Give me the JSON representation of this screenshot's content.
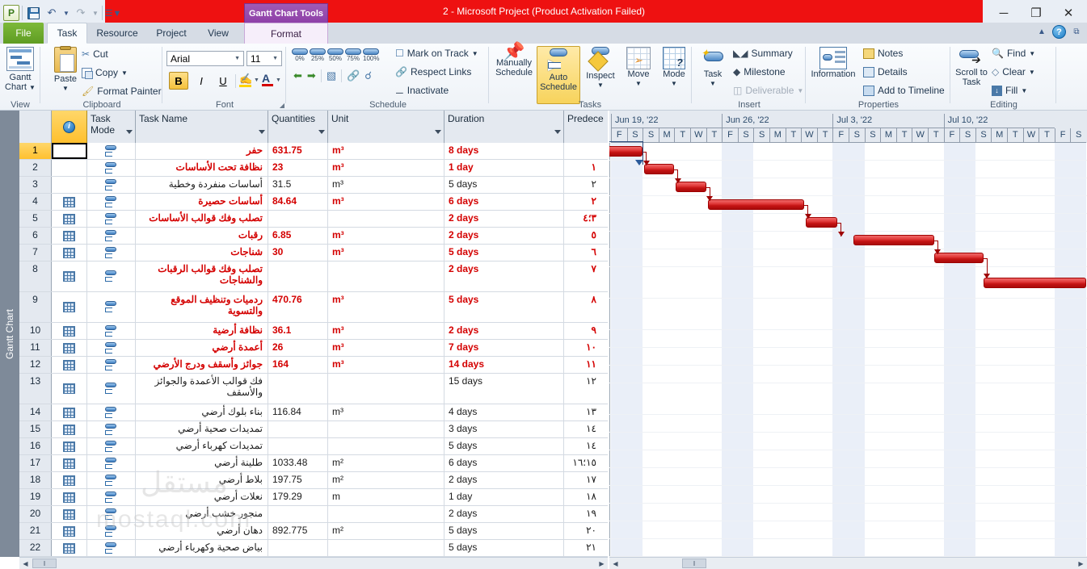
{
  "window": {
    "title": "2 -  Microsoft Project (Product Activation Failed)",
    "contextual_tab": "Gantt Chart Tools",
    "minimize": "─",
    "restore": "❐",
    "close": "✕"
  },
  "quick_access": {
    "app_icon": "P",
    "save_icon": "save-icon",
    "undo_icon": "undo-icon",
    "redo_icon": "redo-icon",
    "customize_icon": "customize-icon"
  },
  "tabs": [
    {
      "label": "File",
      "kind": "file"
    },
    {
      "label": "Task",
      "kind": "selected"
    },
    {
      "label": "Resource",
      "kind": "normal"
    },
    {
      "label": "Project",
      "kind": "normal"
    },
    {
      "label": "View",
      "kind": "normal"
    },
    {
      "label": "Format",
      "kind": "contextual"
    }
  ],
  "help": {
    "collapse_icon": "chevron-up-icon",
    "help_icon": "help-icon",
    "window_icon": "window-icon"
  },
  "ribbon": {
    "groups": [
      {
        "name": "View",
        "items": [
          "Gantt Chart"
        ]
      },
      {
        "name": "Clipboard",
        "items": [
          "Paste",
          "Cut",
          "Copy",
          "Format Painter"
        ]
      },
      {
        "name": "Font",
        "items": [
          "Arial",
          "11",
          "B",
          "I",
          "U"
        ]
      },
      {
        "name": "Schedule",
        "items": [
          "0%",
          "25%",
          "50%",
          "75%",
          "100%",
          "Mark on Track",
          "Respect Links",
          "Inactivate"
        ]
      },
      {
        "name": "Tasks",
        "items": [
          "Manually Schedule",
          "Auto Schedule",
          "Inspect",
          "Move",
          "Mode"
        ]
      },
      {
        "name": "Insert",
        "items": [
          "Task",
          "Summary",
          "Milestone",
          "Deliverable"
        ]
      },
      {
        "name": "Properties",
        "items": [
          "Information",
          "Notes",
          "Details",
          "Add to Timeline"
        ]
      },
      {
        "name": "Editing",
        "items": [
          "Scroll to Task",
          "Find",
          "Clear",
          "Fill"
        ]
      }
    ],
    "view": {
      "gantt_chart": "Gantt Chart"
    },
    "clipboard": {
      "paste": "Paste",
      "cut": "Cut",
      "copy": "Copy",
      "format_painter": "Format Painter"
    },
    "font": {
      "family": "Arial",
      "size": "11",
      "bold": "B",
      "italic": "I",
      "underline": "U"
    },
    "schedule": {
      "p0": "0%",
      "p25": "25%",
      "p50": "50%",
      "p75": "75%",
      "p100": "100%",
      "mark_on_track": "Mark on Track",
      "respect_links": "Respect Links",
      "inactivate": "Inactivate"
    },
    "tasks": {
      "manually_schedule": "Manually Schedule",
      "auto_schedule": "Auto Schedule",
      "inspect": "Inspect",
      "move": "Move",
      "mode": "Mode"
    },
    "insert": {
      "task": "Task",
      "summary": "Summary",
      "milestone": "Milestone",
      "deliverable": "Deliverable"
    },
    "properties": {
      "information": "Information",
      "notes": "Notes",
      "details": "Details",
      "add_to_timeline": "Add to Timeline"
    },
    "editing": {
      "scroll_to_task": "Scroll to Task",
      "find": "Find",
      "clear": "Clear",
      "fill": "Fill"
    }
  },
  "side_label": "Gantt Chart",
  "table": {
    "headers": {
      "indicator": "i",
      "task_mode": "Task Mode",
      "task_name": "Task Name",
      "quantities": "Quantities",
      "unit": "Unit",
      "duration": "Duration",
      "predecessors": "Predece"
    },
    "rows": [
      {
        "id": "1",
        "name": "حفر",
        "qty": "631.75",
        "unit": "m³",
        "dur": "8 days",
        "pred": "",
        "red": true,
        "indicator": false,
        "selected": true,
        "h": 21
      },
      {
        "id": "2",
        "name": "نظافة تحت الأساسات",
        "qty": "23",
        "unit": "m³",
        "dur": "1 day",
        "pred": "١",
        "red": true,
        "indicator": false,
        "h": 21
      },
      {
        "id": "3",
        "name": "أساسات منفردة وخطية",
        "qty": "31.5",
        "unit": "m³",
        "dur": "5 days",
        "pred": "٢",
        "red": false,
        "indicator": false,
        "h": 21
      },
      {
        "id": "4",
        "name": "أساسات حصيرة",
        "qty": "84.64",
        "unit": "m³",
        "dur": "6 days",
        "pred": "٢",
        "red": true,
        "indicator": true,
        "h": 21
      },
      {
        "id": "5",
        "name": "تصلب وفك قوالب الأساسات",
        "qty": "",
        "unit": "",
        "dur": "2 days",
        "pred": "٣؛٤",
        "red": true,
        "indicator": true,
        "h": 21
      },
      {
        "id": "6",
        "name": "رقبات",
        "qty": "6.85",
        "unit": "m³",
        "dur": "2 days",
        "pred": "٥",
        "red": true,
        "indicator": true,
        "h": 21
      },
      {
        "id": "7",
        "name": "شناجات",
        "qty": "30",
        "unit": "m³",
        "dur": "5 days",
        "pred": "٦",
        "red": true,
        "indicator": true,
        "h": 21
      },
      {
        "id": "8",
        "name": "تصلب وفك قوالب الرقبات والشناجات",
        "qty": "",
        "unit": "",
        "dur": "2 days",
        "pred": "٧",
        "red": true,
        "indicator": true,
        "h": 38
      },
      {
        "id": "9",
        "name": "ردميات وتنظيف الموقع والتسوية",
        "qty": "470.76",
        "unit": "m³",
        "dur": "5 days",
        "pred": "٨",
        "red": true,
        "indicator": true,
        "h": 38
      },
      {
        "id": "10",
        "name": "نظافة أرضية",
        "qty": "36.1",
        "unit": "m³",
        "dur": "2 days",
        "pred": "٩",
        "red": true,
        "indicator": true,
        "h": 21
      },
      {
        "id": "11",
        "name": "أعمدة أرضي",
        "qty": "26",
        "unit": "m³",
        "dur": "7 days",
        "pred": "١٠",
        "red": true,
        "indicator": true,
        "h": 21
      },
      {
        "id": "12",
        "name": "جوائز وأسقف ودرج الأرضي",
        "qty": "164",
        "unit": "m³",
        "dur": "14 days",
        "pred": "١١",
        "red": true,
        "indicator": true,
        "h": 21
      },
      {
        "id": "13",
        "name": "فك قوالب الأعمدة والجوائز والأسقف",
        "qty": "",
        "unit": "",
        "dur": "15 days",
        "pred": "١٢",
        "red": false,
        "indicator": true,
        "h": 38
      },
      {
        "id": "14",
        "name": "بناء بلوك أرضي",
        "qty": "116.84",
        "unit": "m³",
        "dur": "4 days",
        "pred": "١٣",
        "red": false,
        "indicator": true,
        "h": 21
      },
      {
        "id": "15",
        "name": "تمديدات صحية أرضي",
        "qty": "",
        "unit": "",
        "dur": "3 days",
        "pred": "١٤",
        "red": false,
        "indicator": true,
        "h": 21
      },
      {
        "id": "16",
        "name": "تمديدات كهرباء أرضي",
        "qty": "",
        "unit": "",
        "dur": "5 days",
        "pred": "١٤",
        "red": false,
        "indicator": true,
        "h": 21
      },
      {
        "id": "17",
        "name": "طلينة أرضي",
        "qty": "1033.48",
        "unit": "m²",
        "dur": "6 days",
        "pred": "١٥؛١٦",
        "red": false,
        "indicator": true,
        "h": 21
      },
      {
        "id": "18",
        "name": "بلاط أرضي",
        "qty": "197.75",
        "unit": "m²",
        "dur": "2 days",
        "pred": "١٧",
        "red": false,
        "indicator": true,
        "h": 21
      },
      {
        "id": "19",
        "name": "نعلات أرضي",
        "qty": "179.29",
        "unit": "m",
        "dur": "1 day",
        "pred": "١٨",
        "red": false,
        "indicator": true,
        "h": 21
      },
      {
        "id": "20",
        "name": "منجور خشب أرضي",
        "qty": "",
        "unit": "",
        "dur": "2 days",
        "pred": "١٩",
        "red": false,
        "indicator": true,
        "h": 21
      },
      {
        "id": "21",
        "name": "دهان أرضي",
        "qty": "892.775",
        "unit": "m²",
        "dur": "5 days",
        "pred": "٢٠",
        "red": false,
        "indicator": true,
        "h": 21
      },
      {
        "id": "22",
        "name": "بياض صحية وكهرباء أرضي",
        "qty": "",
        "unit": "",
        "dur": "5 days",
        "pred": "٢١",
        "red": false,
        "indicator": true,
        "h": 21
      }
    ]
  },
  "chart_data": {
    "type": "bar",
    "title": "Gantt Chart",
    "weeks": [
      "Jun 19, '22",
      "Jun 26, '22",
      "Jul 3, '22",
      "Jul 10, '22"
    ],
    "day_letters": [
      "F",
      "S",
      "S",
      "M",
      "T",
      "W",
      "T",
      "F",
      "S",
      "S",
      "M",
      "T",
      "W",
      "T",
      "F",
      "S",
      "S",
      "M",
      "T",
      "W",
      "T",
      "F",
      "S",
      "S",
      "M",
      "T",
      "W",
      "T",
      "F",
      "S"
    ],
    "weekend_day_indices": [
      0,
      1,
      7,
      8,
      14,
      15,
      21,
      22,
      28,
      29
    ],
    "bars": [
      {
        "task_id": "1",
        "row": 1,
        "start_day": -1.0,
        "length_days": 3.0,
        "color": "#d02020"
      },
      {
        "task_id": "2",
        "row": 2,
        "start_day": 2.1,
        "length_days": 1.9,
        "color": "#d02020"
      },
      {
        "task_id": "3",
        "row": 3,
        "start_day": 4.1,
        "length_days": 1.9,
        "color": "#d02020"
      },
      {
        "task_id": "4",
        "row": 4,
        "start_day": 6.1,
        "length_days": 6.1,
        "color": "#d02020"
      },
      {
        "task_id": "5",
        "row": 5,
        "start_day": 12.3,
        "length_days": 2.0,
        "color": "#d02020"
      },
      {
        "task_id": "6",
        "row": 6,
        "start_day": 15.3,
        "length_days": 5.1,
        "color": "#d02020"
      },
      {
        "task_id": "7",
        "row": 7,
        "start_day": 20.4,
        "length_days": 3.1,
        "color": "#d02020"
      },
      {
        "task_id": "8",
        "row": 8,
        "start_day": 23.5,
        "length_days": 6.5,
        "color": "#d02020"
      }
    ],
    "bar_color": "#d02020",
    "link_color": "#9e0000",
    "xlabel": "",
    "ylabel": ""
  },
  "watermark": {
    "text": "mostaql.com",
    "arabic": "مستقل"
  },
  "status": {
    "hscroll_left": "◀",
    "hscroll_right": "▶",
    "grip": "‖"
  }
}
